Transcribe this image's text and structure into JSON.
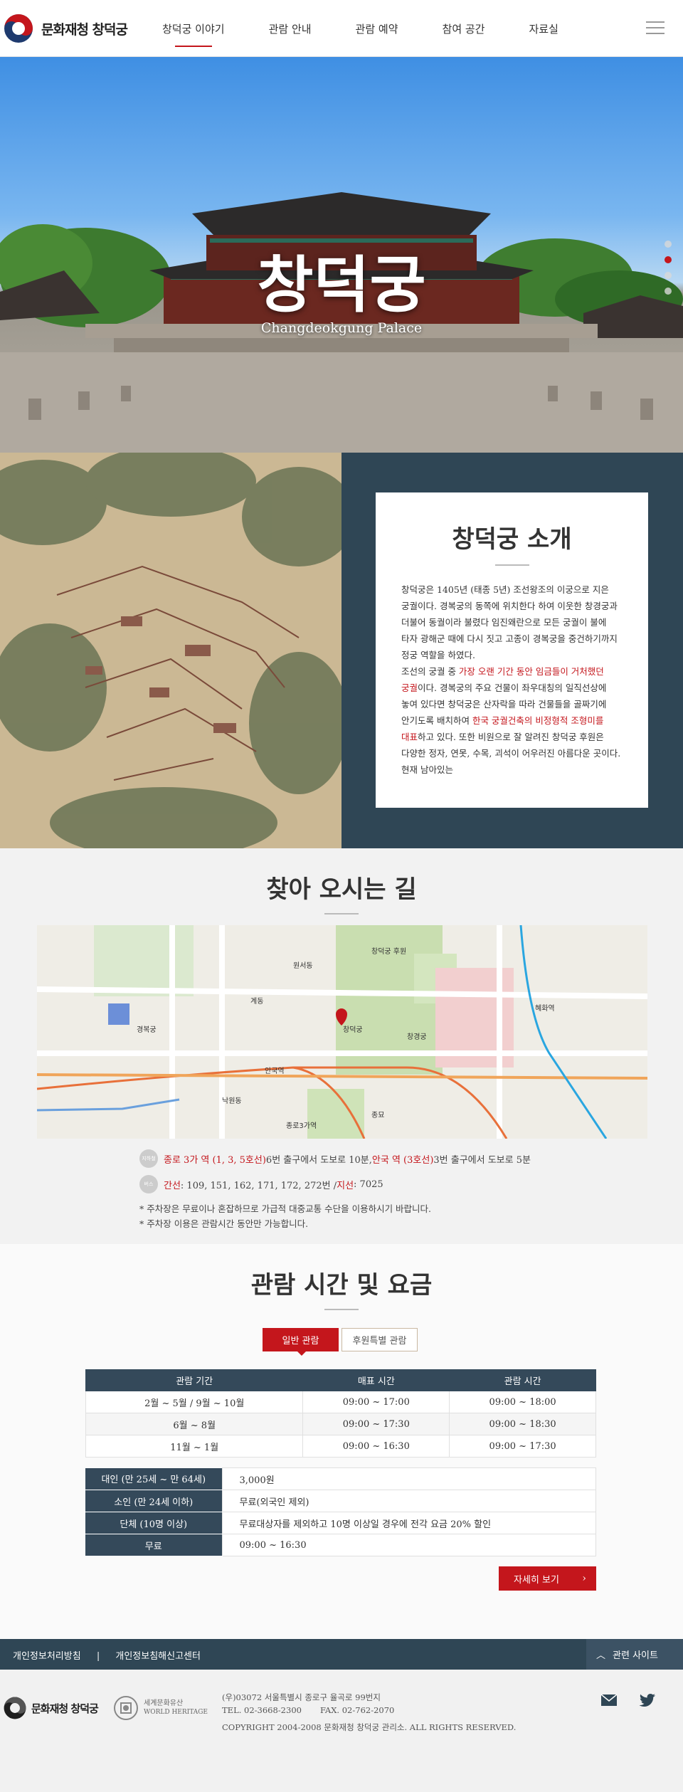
{
  "header": {
    "logo_text": "문화재청 창덕궁",
    "nav": [
      "창덕궁 이야기",
      "관람 안내",
      "관람 예약",
      "참여 공간",
      "자료실"
    ],
    "active_index": 0
  },
  "hero": {
    "title": "창덕궁",
    "subtitle": "Changdeokgung Palace",
    "slides": 4,
    "active_slide": 1
  },
  "intro": {
    "title": "창덕궁 소개",
    "p1": "창덕궁은 1405년 (태종 5년) 조선왕조의 이궁으로 지은 궁궐이다. 경복궁의 동쪽에 위치한다 하여 이웃한 창경궁과 더불어 동궐이라 불렸다 임진왜란으로 모든 궁궐이 불에 타자 광해군 때에 다시 짓고 고종이 경복궁을 중건하기까지 정궁 역할을 하였다.",
    "p2a": "조선의 궁궐 중 ",
    "p2_hl1": "가장 오랜 기간 동안 임금들이 거처했던 궁궐",
    "p2b": "이다. 경복궁의 주요 건물이 좌우대칭의 일직선상에 놓여 있다면 창덕궁은 산자락을 따라 건물들을 골짜기에 안기도록 배치하여 ",
    "p2_hl2": "한국 궁궐건축의 비정형적 조형미를 대표",
    "p2c": "하고 있다. 또한 비원으로 잘 알려진 창덕궁 후원은 다양한 정자, 연못, 수목, 괴석이 어우러진 아름다운 곳이다. 현재 남아있는"
  },
  "directions": {
    "title": "찾아 오시는 길",
    "subway_icon": "지하철",
    "subway_hl1": "종로 3가 역 (1, 3, 5호선)",
    "subway_t1": " 6번 출구에서 도보로 10분, ",
    "subway_hl2": "안국 역 (3호선)",
    "subway_t2": " 3번 출구에서 도보로 5분",
    "bus_icon": "버스",
    "bus_hl1": "간선",
    "bus_t1": " : 109, 151, 162, 171, 172, 272번 / ",
    "bus_hl2": "지선",
    "bus_t2": " : 7025",
    "note1": "* 주차장은 무료이나 혼잡하므로 가급적 대중교통 수단을 이용하시기 바랍니다.",
    "note2": "* 주차장 이용은 관람시간 동안만 가능합니다.",
    "map_labels": [
      "창덕궁",
      "안국역",
      "종로3가역",
      "경복궁",
      "창경궁",
      "종묘",
      "원서동",
      "계동",
      "낙원동",
      "혜화역",
      "창덕궁 후원"
    ]
  },
  "hours": {
    "title": "관람 시간 및 요금",
    "tabs": [
      "일반 관람",
      "후원특별 관람"
    ],
    "active_tab": 0,
    "table_headers": [
      "관람 기간",
      "매표 시간",
      "관람 시간"
    ],
    "rows": [
      [
        "2월 ~ 5월 / 9월 ~ 10월",
        "09:00 ~ 17:00",
        "09:00 ~ 18:00"
      ],
      [
        "6월 ~ 8월",
        "09:00 ~ 17:30",
        "09:00 ~ 18:30"
      ],
      [
        "11월 ~ 1월",
        "09:00 ~ 16:30",
        "09:00 ~ 17:30"
      ]
    ],
    "fees": [
      [
        "대인 (만 25세 ~ 만 64세)",
        "3,000원"
      ],
      [
        "소인 (만 24세 이하)",
        "무료(외국인 제외)"
      ],
      [
        "단체 (10명 이상)",
        "무료대상자를 제외하고 10명 이상일 경우에 전각 요금 20% 할인"
      ],
      [
        "무료",
        "09:00 ~ 16:30"
      ]
    ],
    "more": "자세히 보기"
  },
  "footer": {
    "links": [
      "개인정보처리방침",
      "|",
      "개인정보침해신고센터"
    ],
    "related": "관련 사이트",
    "logo_text": "문화재청 창덕궁",
    "heritage1": "세계문화유산",
    "heritage2": "WORLD HERITAGE",
    "addr": "(우)03072 서울특별시 종로구 율곡로 99번지",
    "tel": "TEL. 02-3668-2300",
    "fax": "FAX. 02-762-2070",
    "copy": "COPYRIGHT 2004-2008 문화재청 창덕궁 관리소. ALL RIGHTS RESERVED.",
    "colors": {
      "brand_red": "#c4161c",
      "navy": "#2f4655"
    }
  }
}
